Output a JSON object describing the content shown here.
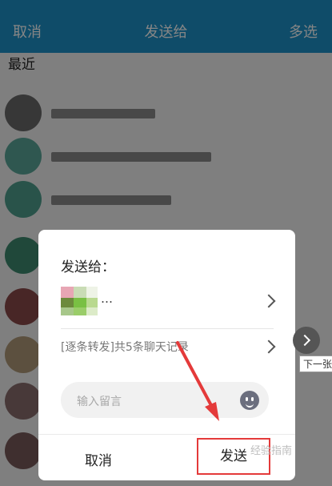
{
  "nav": {
    "cancel": "取消",
    "title": "发送给",
    "multi_select": "多选"
  },
  "recent_label": "最近",
  "dialog": {
    "title": "发送给：",
    "recipient_name": "…",
    "history_text": "[逐条转发]共5条聊天记录",
    "message_placeholder": "输入留言",
    "cancel_label": "取消",
    "send_label": "发送"
  },
  "next_label": "下一张",
  "watermark": "经验指南",
  "colors": {
    "nav_bg": "#1e93c9",
    "highlight_border": "#e43a3a"
  },
  "icons": [
    "chevron-right-icon",
    "emoji-icon",
    "next-arrow-icon"
  ]
}
